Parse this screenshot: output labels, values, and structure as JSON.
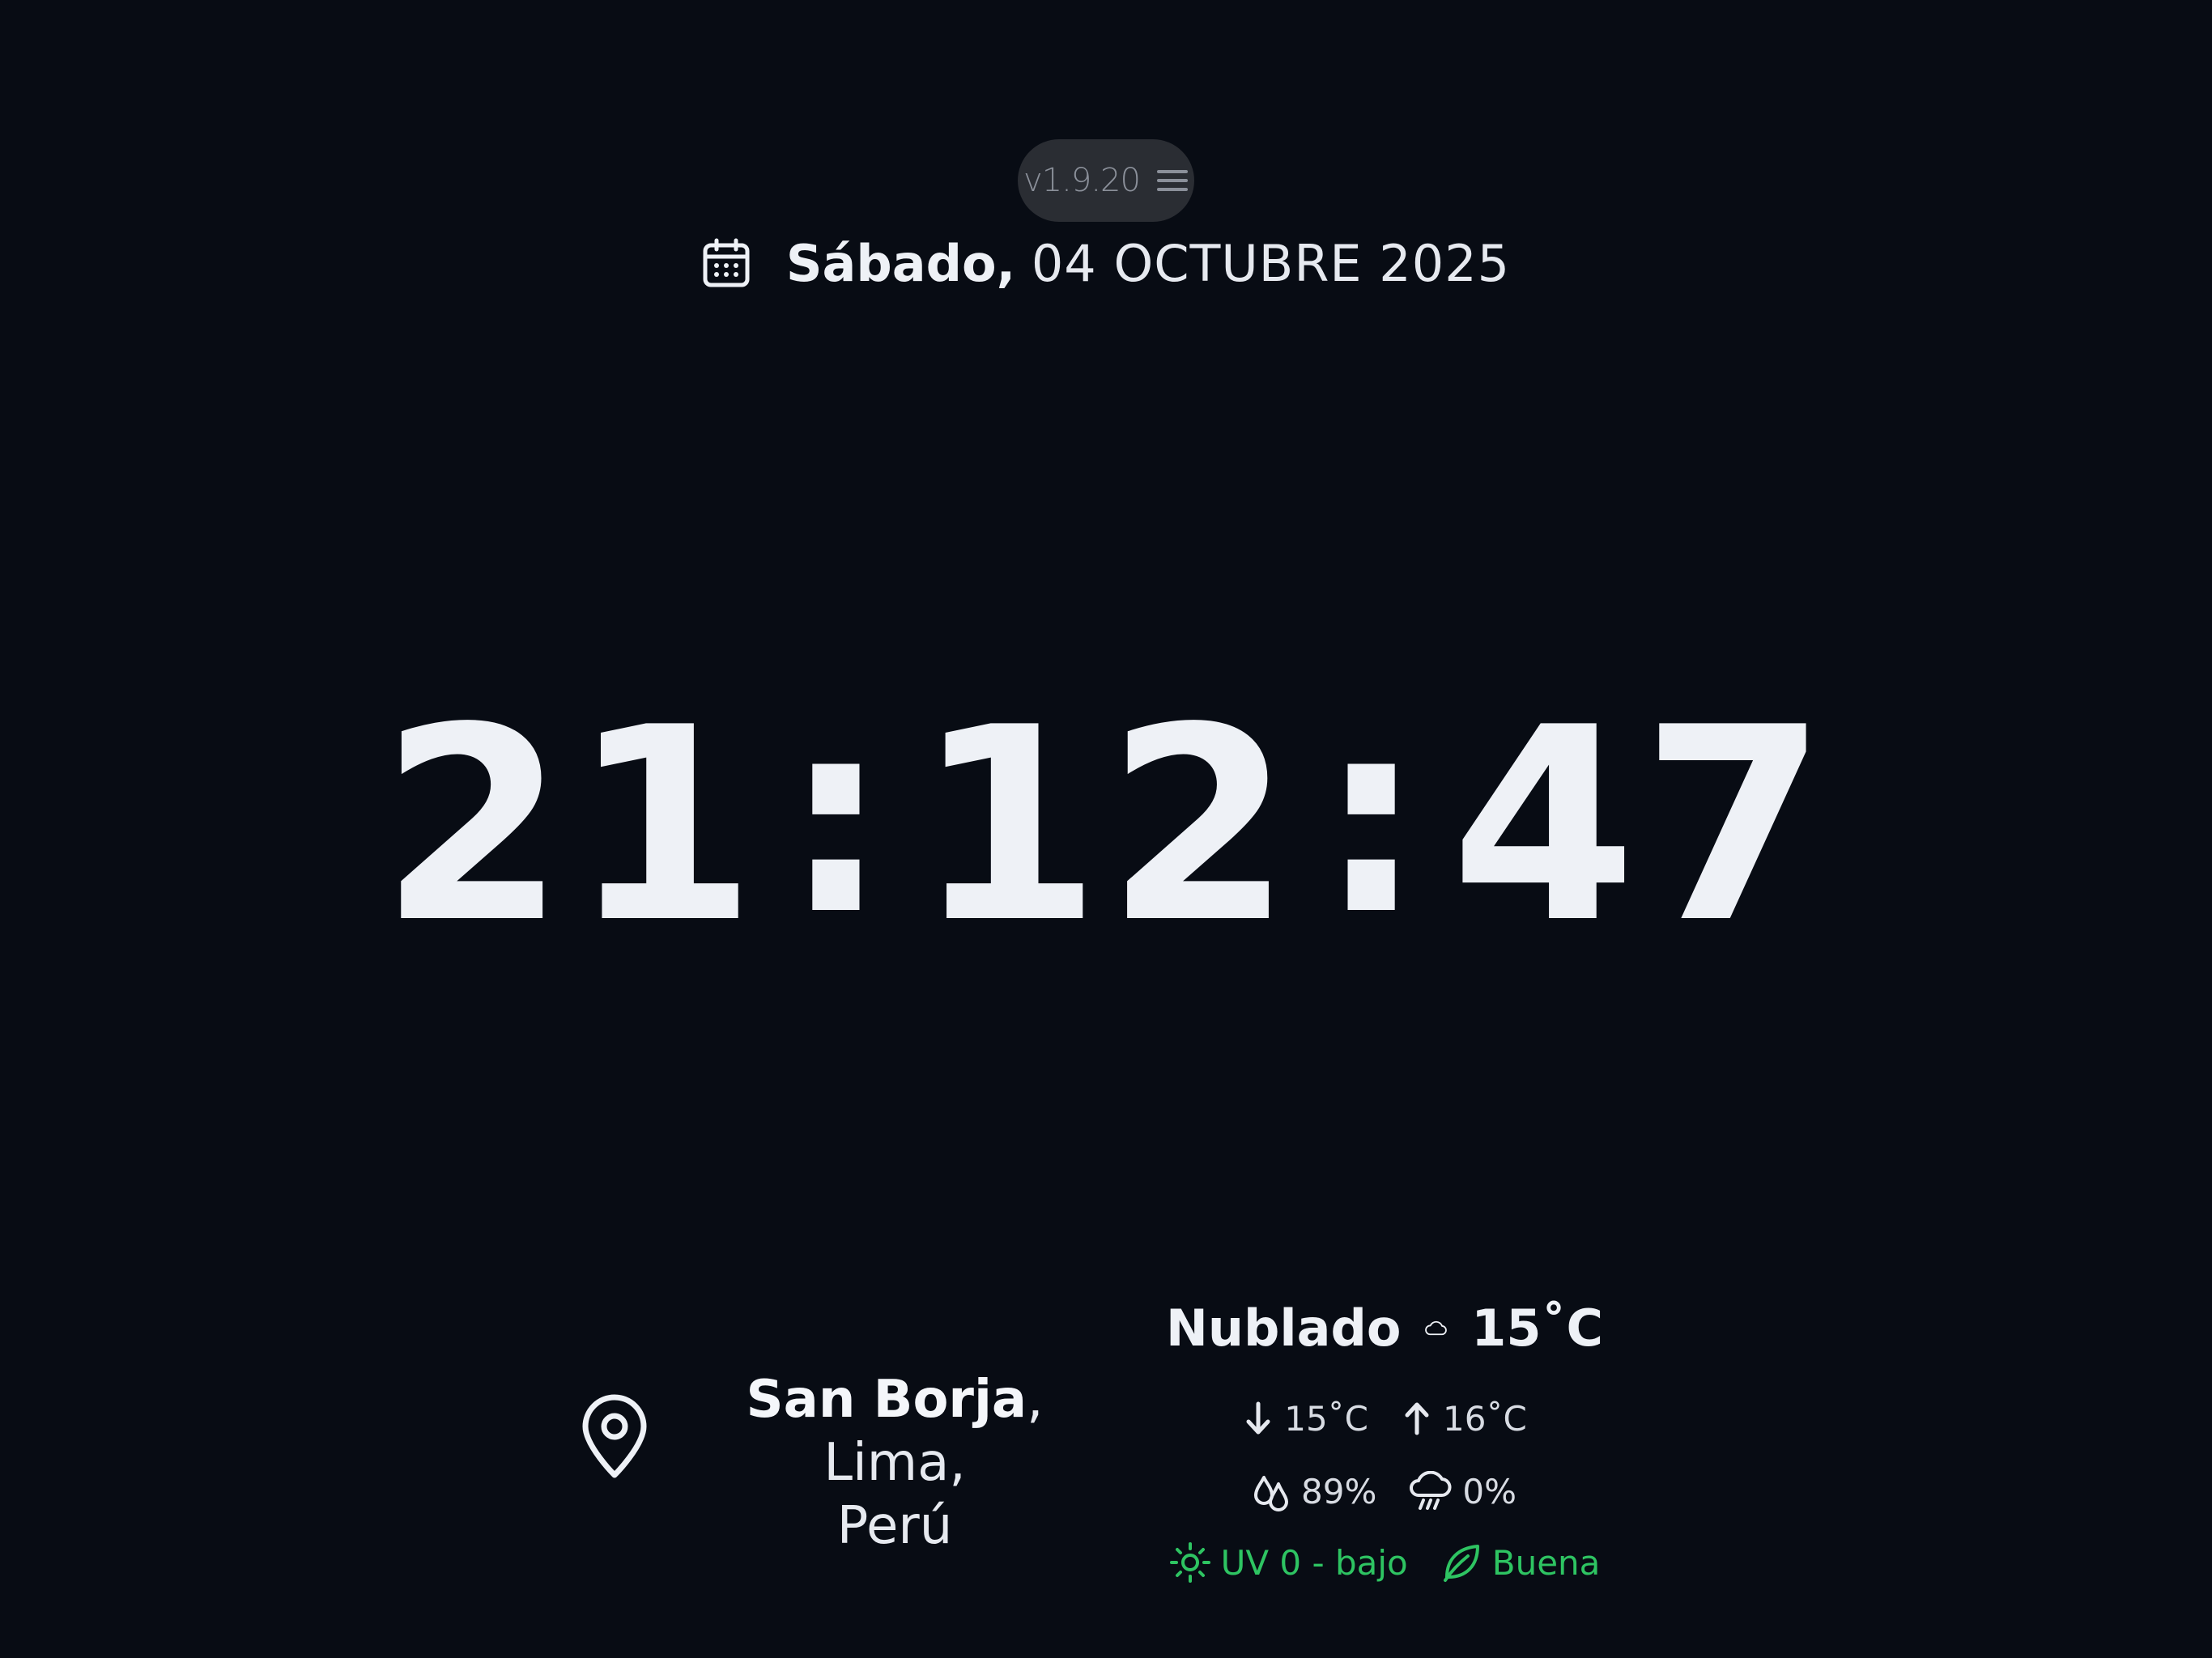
{
  "header": {
    "version": "v1.9.20",
    "menu_icon": "menu-icon"
  },
  "date": {
    "icon": "calendar-icon",
    "weekday": "Sábado,",
    "rest": "04 OCTUBRE 2025"
  },
  "clock": {
    "hours": "21",
    "minutes": "12",
    "seconds": "47",
    "separator": ":"
  },
  "location": {
    "icon": "location-pin-icon",
    "district": "San Borja",
    "city": ", Lima,",
    "country": "Perú"
  },
  "weather": {
    "condition": "Nublado",
    "condition_icon": "cloud-icon",
    "temperature": "15˚C",
    "min_temp": "15˚C",
    "max_temp": "16˚C",
    "humidity": "89%",
    "rain_chance": "0%",
    "uv": "UV 0 - bajo",
    "air_quality": "Buena",
    "accent_color": "#2ec462"
  }
}
